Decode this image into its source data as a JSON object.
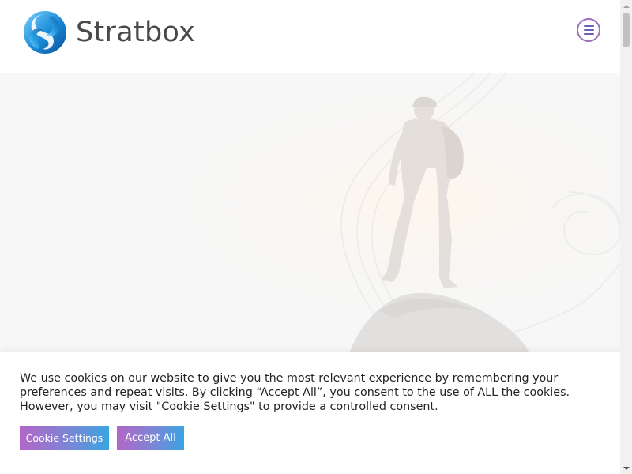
{
  "header": {
    "brand_name": "Stratbox",
    "logo_icon": "stratbox-logo-icon",
    "menu_icon": "hamburger-menu-icon"
  },
  "hero": {
    "image": "hiker-silhouette-misty-background"
  },
  "cookie_banner": {
    "message": "We use cookies on our website to give you the most relevant experience by remembering your preferences and repeat visits. By clicking “Accept All”, you consent to the use of ALL the cookies. However, you may visit \"Cookie Settings\" to provide a controlled consent.",
    "settings_label": "Cookie Settings",
    "accept_label": "Accept All"
  },
  "colors": {
    "brand_text": "#4a4a4a",
    "button_gradient_start": "#b266c6",
    "button_gradient_end": "#3aa4e2",
    "menu_border": "#9b6fc2"
  }
}
